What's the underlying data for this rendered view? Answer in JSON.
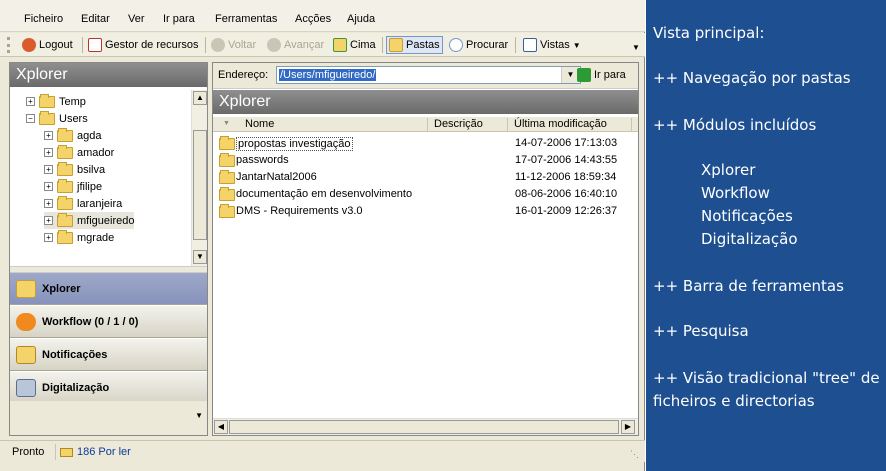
{
  "menu": [
    "Ficheiro",
    "Editar",
    "Ver",
    "Ir para",
    "Ferramentas",
    "Acções",
    "Ajuda"
  ],
  "toolbar": {
    "logout": "Logout",
    "resources": "Gestor de recursos",
    "back": "Voltar",
    "forward": "Avançar",
    "up": "Cima",
    "folders": "Pastas",
    "search": "Procurar",
    "views": "Vistas"
  },
  "left_header": "Xplorer",
  "tree": [
    "Temp",
    "Users",
    "agda",
    "amador",
    "bsilva",
    "jfilipe",
    "laranjeira",
    "mfigueiredo",
    "mgrade"
  ],
  "nav": {
    "xplorer": "Xplorer",
    "workflow": "Workflow (0 / 1 / 0)",
    "notifications": "Notificações",
    "digitalization": "Digitalização"
  },
  "address": {
    "label": "Endereço:",
    "value": "/Users/mfigueiredo/",
    "go": "Ir para"
  },
  "right_header": "Xplorer",
  "columns": {
    "name": "Nome",
    "description": "Descrição",
    "modified": "Última modificação"
  },
  "files": [
    {
      "name": "propostas investigação",
      "modified": "14-07-2006 17:13:03"
    },
    {
      "name": "passwords",
      "modified": "17-07-2006 14:43:55"
    },
    {
      "name": "JantarNatal2006",
      "modified": "11-12-2006 18:59:34"
    },
    {
      "name": "documentação em desenvolvimento",
      "modified": "08-06-2006 16:40:10"
    },
    {
      "name": "DMS - Requirements v3.0",
      "modified": "16-01-2009 12:26:37"
    }
  ],
  "status": {
    "text": "Pronto",
    "unread": "186 Por ler"
  },
  "side": {
    "title": "Vista principal:",
    "b1": "++ Navegação por pastas",
    "b2": "++ Módulos incluídos",
    "modules": [
      "Xplorer",
      "Workflow",
      "Notificações",
      "Digitalização"
    ],
    "b3": "++ Barra de ferramentas",
    "b4": "++ Pesquisa",
    "b5a": "++ Visão tradicional \"tree\" de",
    "b5b": "ficheiros e directorias"
  },
  "colors": {
    "accent": "#1d4f91",
    "selected_nav": "#8793bb"
  }
}
